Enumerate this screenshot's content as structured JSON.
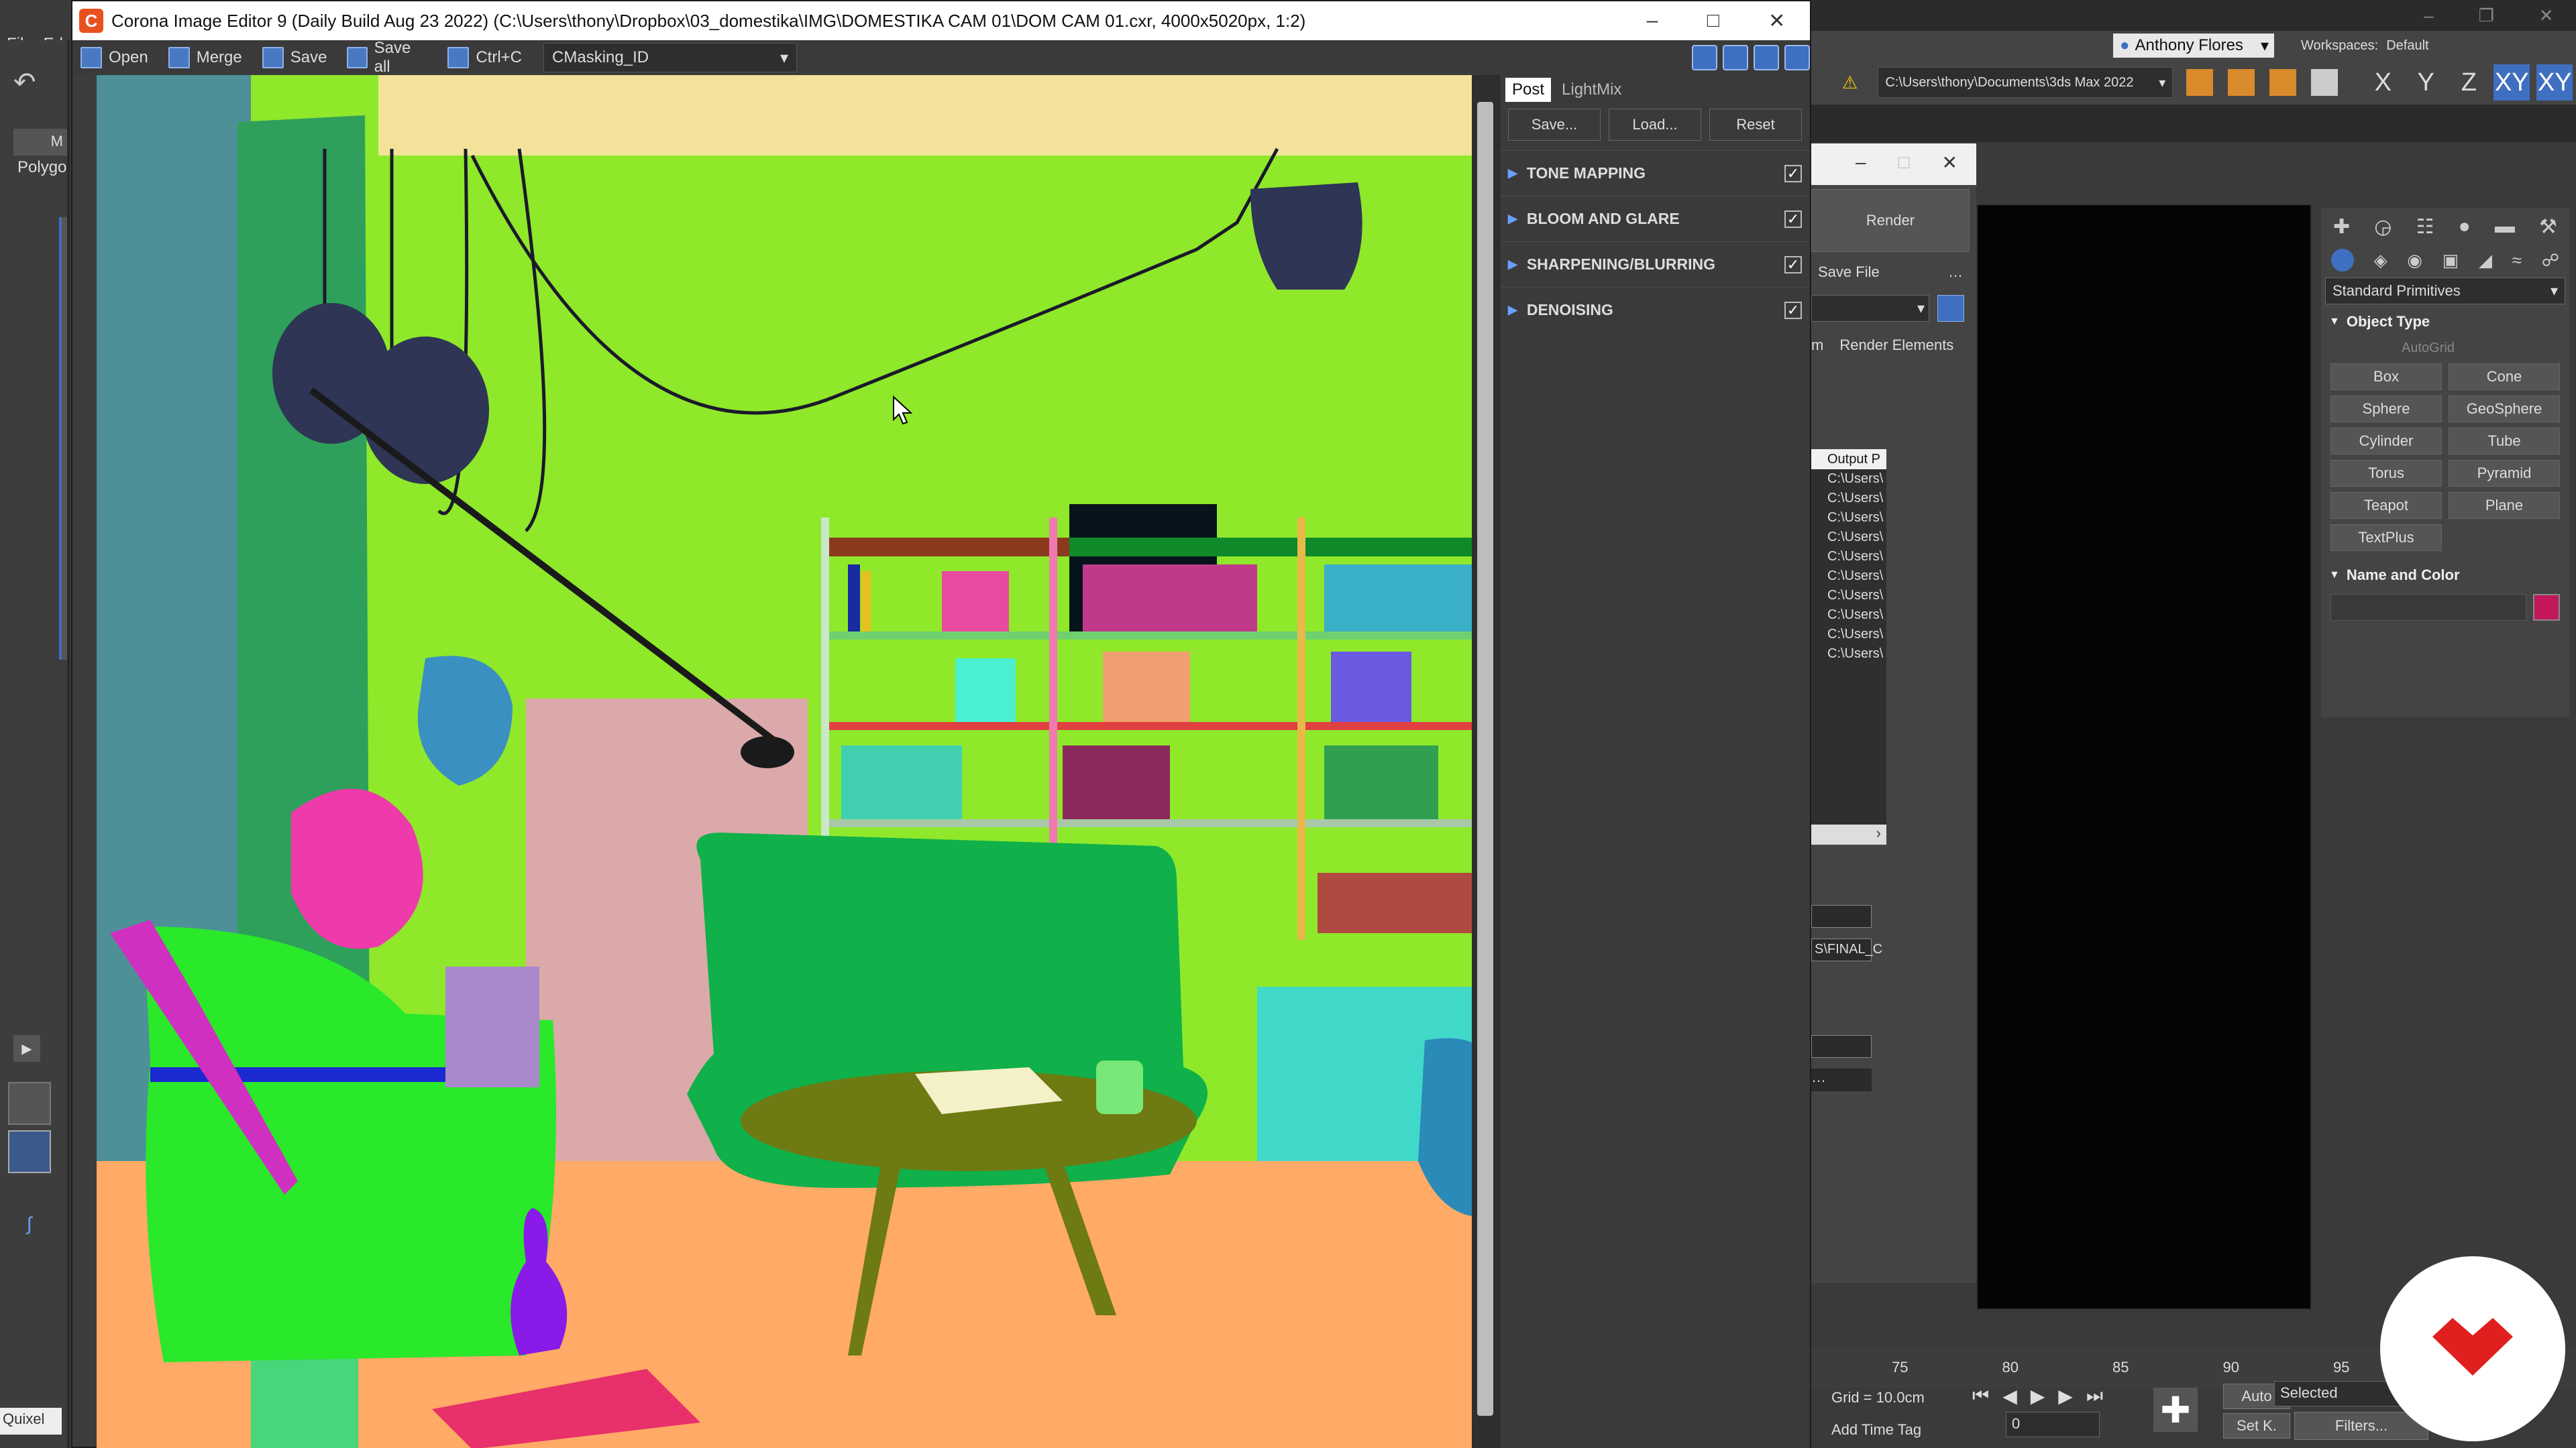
{
  "corona": {
    "title": "Corona Image Editor 9 (Daily Build Aug 23 2022) (C:\\Users\\thony\\Dropbox\\03_domestika\\IMG\\DOMESTIKA CAM 01\\DOM CAM 01.cxr, 4000x5020px, 1:2)",
    "logo": "C",
    "toolbar": {
      "open": "Open",
      "merge": "Merge",
      "save": "Save",
      "save_all": "Save all",
      "copy": "Ctrl+C",
      "view_select": "CMasking_ID"
    },
    "post_panel": {
      "tabs": [
        "Post",
        "LightMix"
      ],
      "buttons": {
        "save": "Save...",
        "load": "Load...",
        "reset": "Reset"
      },
      "sections": [
        {
          "label": "TONE MAPPING",
          "checked": true
        },
        {
          "label": "BLOOM AND GLARE",
          "checked": true
        },
        {
          "label": "SHARPENING/BLURRING",
          "checked": true
        },
        {
          "label": "DENOISING",
          "checked": true
        }
      ]
    }
  },
  "max": {
    "menu": [
      "File",
      "Ed"
    ],
    "user": "Anthony Flores",
    "workspaces_label": "Workspaces:",
    "workspace_value": "Default",
    "project_path": "C:\\Users\\thony\\Documents\\3ds Max 2022",
    "axes": [
      "X",
      "Y",
      "Z",
      "XY",
      "XY"
    ],
    "render_label": "Render",
    "save_file": "Save File",
    "render_elements": "Render Elements",
    "render_tab_partial": "m",
    "output_header": "Output P",
    "output_rows": [
      "C:\\Users\\",
      "C:\\Users\\",
      "C:\\Users\\",
      "C:\\Users\\",
      "C:\\Users\\",
      "C:\\Users\\",
      "C:\\Users\\",
      "C:\\Users\\",
      "C:\\Users\\",
      "C:\\Users\\"
    ],
    "final_field": "S\\FINAL_C",
    "left_panel": {
      "mode": "M",
      "polygon": "Polygo",
      "quixel": "Quixel"
    },
    "command_panel": {
      "primitives_dropdown": "Standard Primitives",
      "object_type": "Object Type",
      "autogrid": "AutoGrid",
      "primitives": [
        "Box",
        "Cone",
        "Sphere",
        "GeoSphere",
        "Cylinder",
        "Tube",
        "Torus",
        "Pyramid",
        "Teapot",
        "Plane",
        "TextPlus"
      ],
      "name_and_color": "Name and Color",
      "swatch_color": "#c2185b"
    },
    "timeline_ticks": [
      "75",
      "80",
      "85",
      "90",
      "95"
    ],
    "status": {
      "grid": "Grid = 10.0cm",
      "add_time_tag": "Add Time Tag",
      "auto": "Auto",
      "set_key": "Set K.",
      "selected": "Selected",
      "filters": "Filters...",
      "frame": "0"
    }
  },
  "colors": {
    "accent_blue": "#3f6fc0",
    "corona_orange": "#e8501e",
    "domestika_red": "#e0201e"
  }
}
